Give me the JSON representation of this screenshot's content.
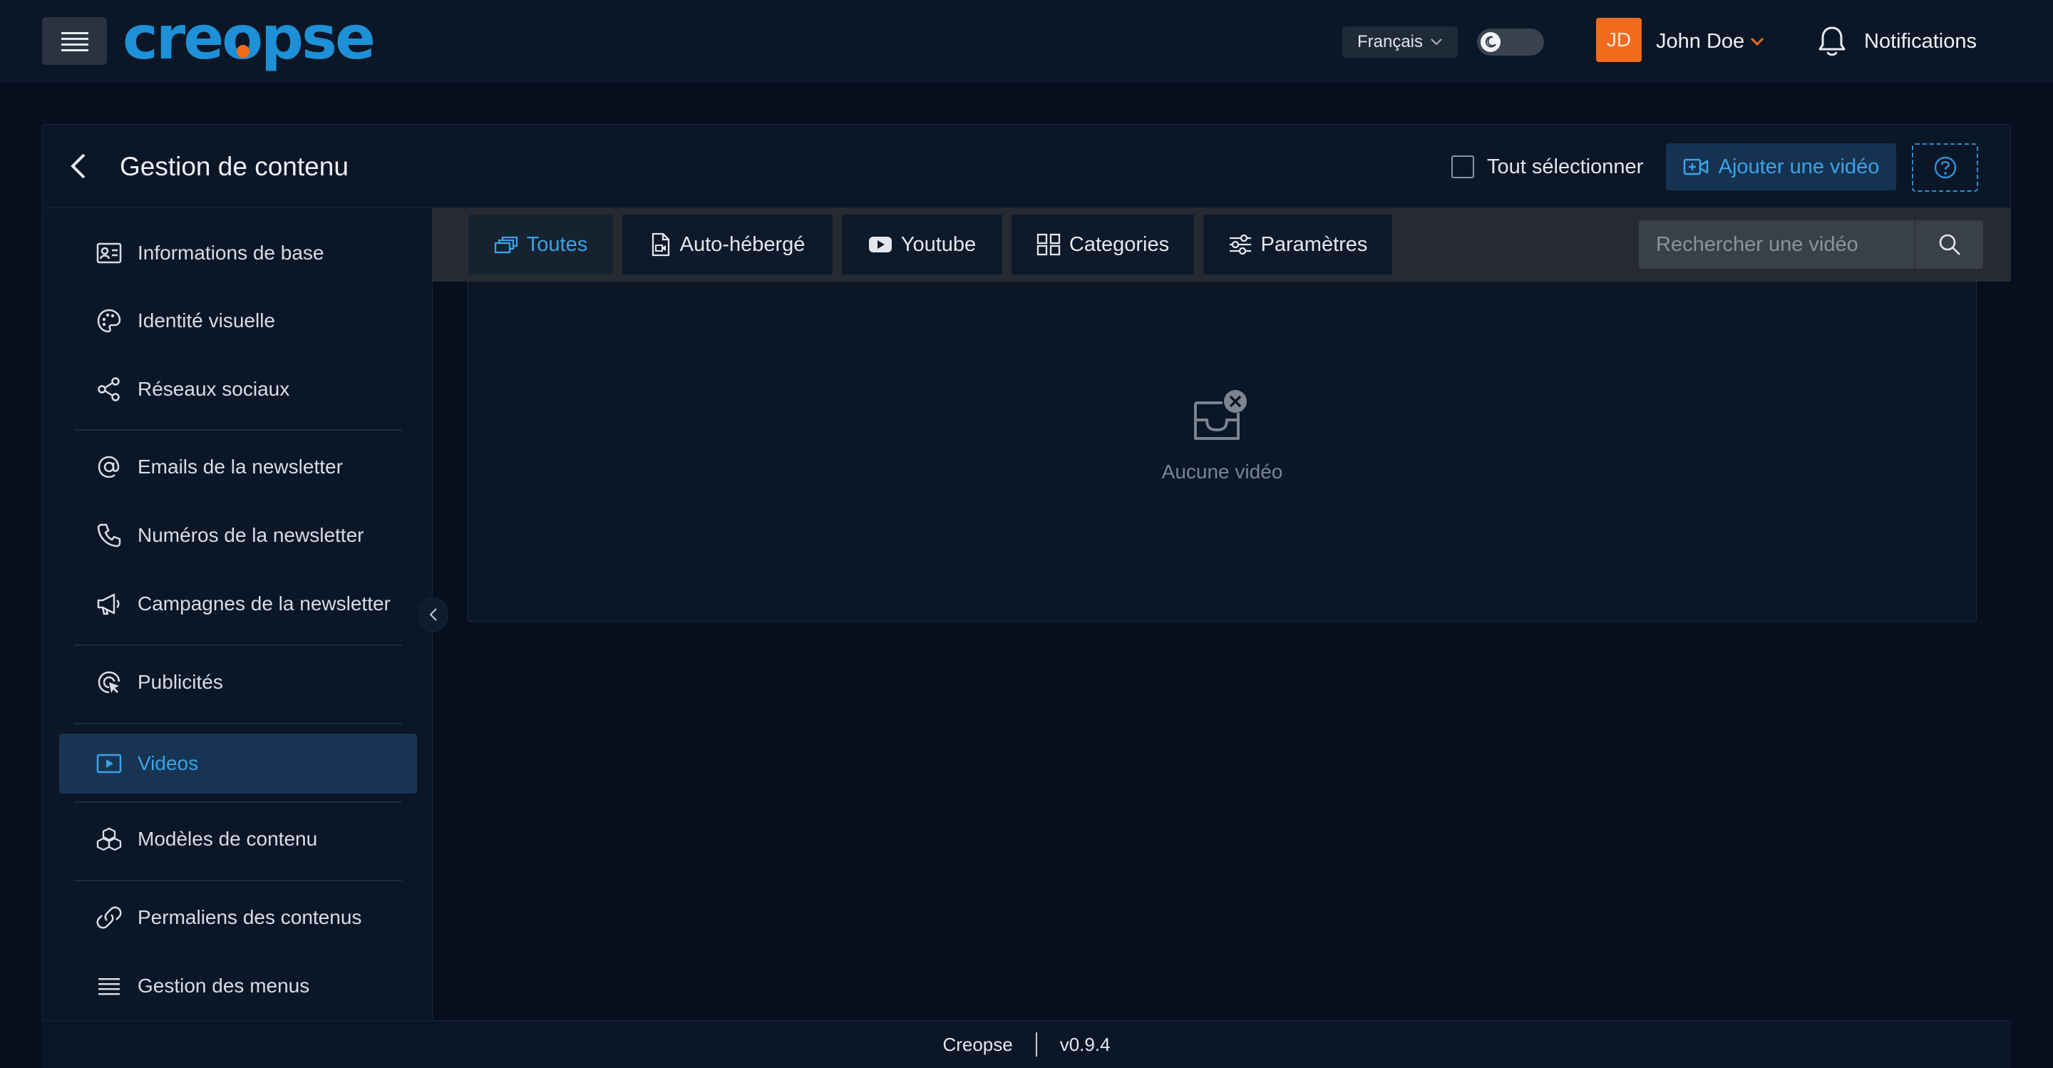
{
  "app": {
    "logo_text": "creopse",
    "accent_color": "#1e90d8",
    "logo_dot_color": "#f26b1d"
  },
  "topbar": {
    "menu_icon": "hamburger-icon",
    "language": "Français",
    "theme_icon": "moon-icon",
    "user": {
      "initials": "JD",
      "name": "John Doe",
      "avatar_color": "#f26b1d"
    },
    "notifications_label": "Notifications"
  },
  "header": {
    "title": "Gestion de contenu",
    "select_all_label": "Tout sélectionner",
    "add_video_label": "Ajouter une vidéo"
  },
  "sidebar": {
    "items": [
      {
        "label": "Informations de base",
        "icon": "id-card-icon"
      },
      {
        "label": "Identité visuelle",
        "icon": "palette-icon"
      },
      {
        "label": "Réseaux sociaux",
        "icon": "share-icon"
      },
      {
        "label": "Emails de la newsletter",
        "icon": "at-sign-icon"
      },
      {
        "label": "Numéros de la newsletter",
        "icon": "phone-icon"
      },
      {
        "label": "Campagnes de la newsletter",
        "icon": "megaphone-icon"
      },
      {
        "label": "Publicités",
        "icon": "ad-click-icon"
      },
      {
        "label": "Videos",
        "icon": "video-icon",
        "active": true
      },
      {
        "label": "Modèles de contenu",
        "icon": "cubes-icon"
      },
      {
        "label": "Permaliens des contenus",
        "icon": "link-icon"
      },
      {
        "label": "Gestion des menus",
        "icon": "list-icon"
      }
    ]
  },
  "tabs": [
    {
      "label": "Toutes",
      "icon": "stack-icon",
      "active": true
    },
    {
      "label": "Auto-hébergé",
      "icon": "file-video-icon"
    },
    {
      "label": "Youtube",
      "icon": "youtube-icon"
    },
    {
      "label": "Categories",
      "icon": "grid-icon"
    },
    {
      "label": "Paramètres",
      "icon": "sliders-icon"
    }
  ],
  "search": {
    "placeholder": "Rechercher une vidéo"
  },
  "empty_state": {
    "text": "Aucune vidéo",
    "icon": "empty-inbox-icon"
  },
  "footer": {
    "brand": "Creopse",
    "version": "v0.9.4"
  }
}
